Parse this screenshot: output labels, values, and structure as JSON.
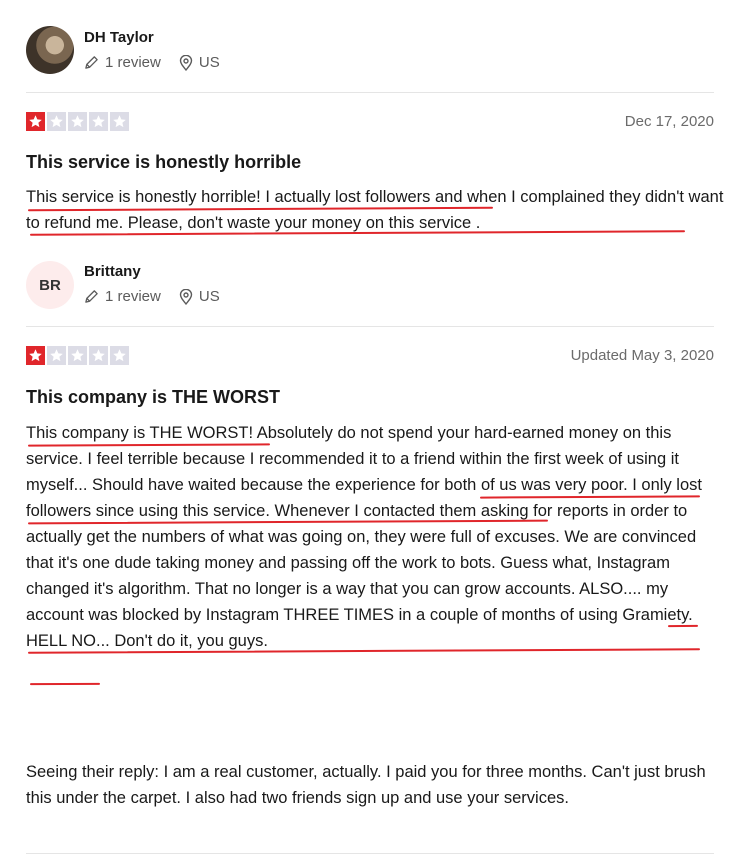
{
  "colors": {
    "star_fill": "#e0262b",
    "star_empty": "#dcdce6",
    "underline": "#e0262b"
  },
  "reviews": [
    {
      "reviewer": {
        "name": "DH Taylor",
        "avatar": "photo",
        "review_count": "1 review",
        "country": "US"
      },
      "rating": 1,
      "date": "Dec 17, 2020",
      "title": "This service is honestly horrible",
      "body": [
        "This service is honestly horrible! I actually lost followers and when I complained they didn't want to refund me. Please, don't waste your money on this service ."
      ]
    },
    {
      "reviewer": {
        "name": "Brittany",
        "avatar_initials": "BR",
        "review_count": "1 review",
        "country": "US"
      },
      "rating": 1,
      "date": "Updated May 3, 2020",
      "title": "This company is THE WORST",
      "body": [
        "This company is THE WORST! Absolutely do not spend your hard-earned money on this service. I feel terrible because I recommended it to a friend within the first week of using it myself... Should have waited because the experience for both of us was very poor. I only lost followers since using this service. Whenever I contacted them asking for reports in order to actually get the numbers of what was going on, they were full of excuses. We are convinced that it's one dude taking money and passing off the work to bots. Guess what, Instagram changed it's algorithm. That no longer is a way that you can grow accounts. ALSO.... my account was blocked by Instagram THREE TIMES in a couple of months of using Gramiety. HELL NO... Don't do it, you guys.",
        "Seeing their reply: I am a real customer, actually. I paid you for three months. Can't just brush this under the carpet. I also had two friends sign up and use your services."
      ]
    }
  ]
}
